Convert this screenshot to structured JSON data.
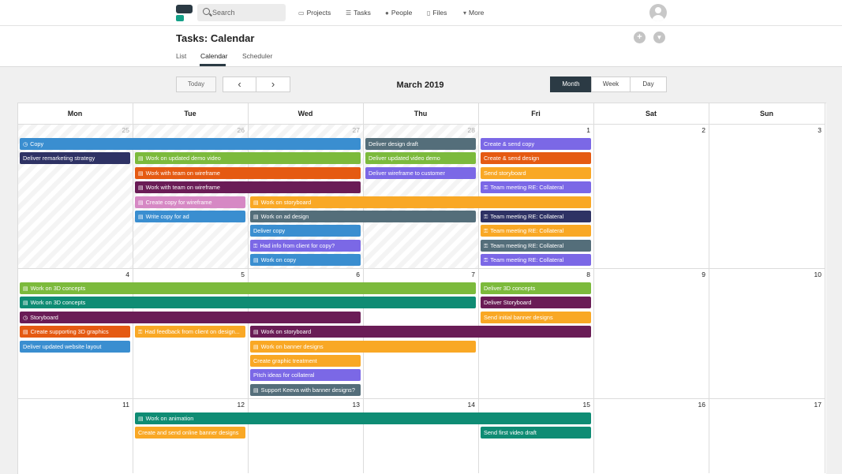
{
  "topbar": {
    "search_placeholder": "Search",
    "nav": [
      {
        "label": "Projects",
        "icon": "folder-icon",
        "glyph": "▭"
      },
      {
        "label": "Tasks",
        "icon": "list-icon",
        "glyph": "☰"
      },
      {
        "label": "People",
        "icon": "person-icon",
        "glyph": "●"
      },
      {
        "label": "Files",
        "icon": "file-icon",
        "glyph": "▯"
      },
      {
        "label": "More",
        "icon": "caret-down-icon",
        "glyph": "▾"
      }
    ]
  },
  "page": {
    "title": "Tasks: Calendar",
    "tabs": [
      {
        "label": "List"
      },
      {
        "label": "Calendar"
      },
      {
        "label": "Scheduler"
      }
    ],
    "active_tab": "Calendar",
    "add_glyph": "+",
    "filter_glyph": "▼"
  },
  "toolbar": {
    "today_label": "Today",
    "prev_glyph": "‹",
    "next_glyph": "›",
    "month_title": "March 2019",
    "views": [
      {
        "label": "Month"
      },
      {
        "label": "Week"
      },
      {
        "label": "Day"
      }
    ],
    "active_view": "Month"
  },
  "calendar": {
    "day_headers": [
      "Mon",
      "Tue",
      "Wed",
      "Thu",
      "Fri",
      "Sat",
      "Sun"
    ],
    "weeks": [
      {
        "days": [
          {
            "n": "25",
            "out": true
          },
          {
            "n": "26",
            "out": true
          },
          {
            "n": "27",
            "out": true
          },
          {
            "n": "28",
            "out": true
          },
          {
            "n": "1"
          },
          {
            "n": "2"
          },
          {
            "n": "3"
          }
        ]
      },
      {
        "days": [
          {
            "n": "4"
          },
          {
            "n": "5"
          },
          {
            "n": "6"
          },
          {
            "n": "7"
          },
          {
            "n": "8"
          },
          {
            "n": "9"
          },
          {
            "n": "10"
          }
        ]
      },
      {
        "days": [
          {
            "n": "11"
          },
          {
            "n": "12"
          },
          {
            "n": "13"
          },
          {
            "n": "14"
          },
          {
            "n": "15"
          },
          {
            "n": "16"
          },
          {
            "n": "17"
          }
        ]
      }
    ],
    "colors": {
      "blue": "#3a8ed0",
      "navy": "#2e3264",
      "green": "#7cba3c",
      "orange": "#e55a12",
      "purple": "#6a1c56",
      "pink": "#d688c4",
      "amber": "#f9a825",
      "slate": "#546e7a",
      "violet": "#7b68e6",
      "teal": "#0f8c74"
    },
    "events": [
      {
        "week": 0,
        "start": 0,
        "span": 3,
        "row": 0,
        "title": "Copy",
        "color": "blue",
        "icon": "clock"
      },
      {
        "week": 0,
        "start": 3,
        "span": 1,
        "row": 0,
        "title": "Deliver design draft",
        "color": "slate"
      },
      {
        "week": 0,
        "start": 4,
        "span": 1,
        "row": 0,
        "title": "Create & send copy",
        "color": "violet"
      },
      {
        "week": 0,
        "start": 0,
        "span": 1,
        "row": 1,
        "title": "Deliver remarketing strategy",
        "color": "navy"
      },
      {
        "week": 0,
        "start": 1,
        "span": 2,
        "row": 1,
        "title": "Work on updated demo video",
        "color": "green",
        "icon": "briefcase"
      },
      {
        "week": 0,
        "start": 3,
        "span": 1,
        "row": 1,
        "title": "Deliver updated video demo",
        "color": "green"
      },
      {
        "week": 0,
        "start": 4,
        "span": 1,
        "row": 1,
        "title": "Create & send design",
        "color": "orange"
      },
      {
        "week": 0,
        "start": 1,
        "span": 2,
        "row": 2,
        "title": "Work with team on wireframe",
        "color": "orange",
        "icon": "briefcase"
      },
      {
        "week": 0,
        "start": 3,
        "span": 1,
        "row": 2,
        "title": "Deliver wireframe to customer",
        "color": "violet"
      },
      {
        "week": 0,
        "start": 4,
        "span": 1,
        "row": 2,
        "title": "Send storyboard",
        "color": "amber"
      },
      {
        "week": 0,
        "start": 1,
        "span": 2,
        "row": 3,
        "title": "Work with team on wireframe",
        "color": "purple",
        "icon": "briefcase"
      },
      {
        "week": 0,
        "start": 4,
        "span": 1,
        "row": 3,
        "title": "Team meeting RE: Collateral",
        "color": "violet",
        "icon": "lock"
      },
      {
        "week": 0,
        "start": 1,
        "span": 1,
        "row": 4,
        "title": "Create copy for wireframe",
        "color": "pink",
        "icon": "briefcase"
      },
      {
        "week": 0,
        "start": 2,
        "span": 3,
        "row": 4,
        "title": "Work on storyboard",
        "color": "amber",
        "icon": "briefcase"
      },
      {
        "week": 0,
        "start": 1,
        "span": 1,
        "row": 5,
        "title": "Write copy for ad",
        "color": "blue",
        "icon": "briefcase"
      },
      {
        "week": 0,
        "start": 2,
        "span": 2,
        "row": 5,
        "title": "Work on ad design",
        "color": "slate",
        "icon": "briefcase"
      },
      {
        "week": 0,
        "start": 4,
        "span": 1,
        "row": 5,
        "title": "Team meeting RE: Collateral",
        "color": "navy",
        "icon": "lock"
      },
      {
        "week": 0,
        "start": 2,
        "span": 1,
        "row": 6,
        "title": "Deliver copy",
        "color": "blue"
      },
      {
        "week": 0,
        "start": 4,
        "span": 1,
        "row": 6,
        "title": "Team meeting RE: Collateral",
        "color": "amber",
        "icon": "lock"
      },
      {
        "week": 0,
        "start": 2,
        "span": 1,
        "row": 7,
        "title": "Had info from client for copy?",
        "color": "violet",
        "icon": "lock"
      },
      {
        "week": 0,
        "start": 4,
        "span": 1,
        "row": 7,
        "title": "Team meeting RE: Collateral",
        "color": "slate",
        "icon": "lock"
      },
      {
        "week": 0,
        "start": 2,
        "span": 1,
        "row": 8,
        "title": "Work on copy",
        "color": "blue",
        "icon": "briefcase"
      },
      {
        "week": 0,
        "start": 4,
        "span": 1,
        "row": 8,
        "title": "Team meeting RE: Collateral",
        "color": "violet",
        "icon": "lock"
      },
      {
        "week": 1,
        "start": 0,
        "span": 4,
        "row": 0,
        "title": "Work on 3D concepts",
        "color": "green",
        "icon": "briefcase"
      },
      {
        "week": 1,
        "start": 4,
        "span": 1,
        "row": 0,
        "title": "Deliver 3D concepts",
        "color": "green"
      },
      {
        "week": 1,
        "start": 0,
        "span": 4,
        "row": 1,
        "title": "Work on 3D concepts",
        "color": "teal",
        "icon": "briefcase"
      },
      {
        "week": 1,
        "start": 4,
        "span": 1,
        "row": 1,
        "title": "Deliver Storyboard",
        "color": "purple"
      },
      {
        "week": 1,
        "start": 0,
        "span": 3,
        "row": 2,
        "title": "Storyboard",
        "color": "purple",
        "icon": "clock"
      },
      {
        "week": 1,
        "start": 4,
        "span": 1,
        "row": 2,
        "title": "Send initial banner designs",
        "color": "amber"
      },
      {
        "week": 1,
        "start": 0,
        "span": 1,
        "row": 3,
        "title": "Create supporting 3D graphics",
        "color": "orange",
        "icon": "briefcase"
      },
      {
        "week": 1,
        "start": 1,
        "span": 1,
        "row": 3,
        "title": "Had feedback from client on design...",
        "color": "amber",
        "icon": "lock"
      },
      {
        "week": 1,
        "start": 2,
        "span": 3,
        "row": 3,
        "title": "Work on storyboard",
        "color": "purple",
        "icon": "briefcase"
      },
      {
        "week": 1,
        "start": 0,
        "span": 1,
        "row": 4,
        "title": "Deliver updated website layout",
        "color": "blue"
      },
      {
        "week": 1,
        "start": 2,
        "span": 2,
        "row": 4,
        "title": "Work on banner designs",
        "color": "amber",
        "icon": "briefcase"
      },
      {
        "week": 1,
        "start": 2,
        "span": 1,
        "row": 5,
        "title": "Create graphic treatment",
        "color": "amber"
      },
      {
        "week": 1,
        "start": 2,
        "span": 1,
        "row": 6,
        "title": "Pitch ideas for collateral",
        "color": "violet"
      },
      {
        "week": 1,
        "start": 2,
        "span": 1,
        "row": 7,
        "title": "Support Keeva with banner designs?",
        "color": "slate",
        "icon": "briefcase"
      },
      {
        "week": 2,
        "start": 1,
        "span": 4,
        "row": 0,
        "title": "Work on animation",
        "color": "teal",
        "icon": "briefcase"
      },
      {
        "week": 2,
        "start": 1,
        "span": 1,
        "row": 1,
        "title": "Create and send online banner designs",
        "color": "amber"
      },
      {
        "week": 2,
        "start": 4,
        "span": 1,
        "row": 1,
        "title": "Send first video draft",
        "color": "teal"
      }
    ]
  }
}
